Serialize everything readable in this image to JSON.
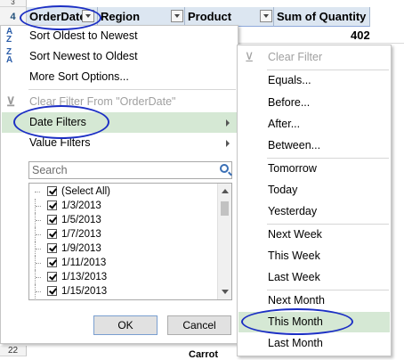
{
  "sheet": {
    "row_numbers": [
      "3",
      "4",
      "22"
    ],
    "headers": [
      "OrderDate",
      "Region",
      "Product",
      "Sum of Quantity"
    ],
    "value": "402",
    "bottom_cell": "Carrot"
  },
  "menu": {
    "items": [
      {
        "label": "Sort Oldest to Newest",
        "icon": "sort-ascending-icon",
        "glyph": "A↓Z"
      },
      {
        "label": "Sort Newest to Oldest",
        "icon": "sort-descending-icon",
        "glyph": "Z↓A"
      },
      {
        "label": "More Sort Options...",
        "icon": ""
      },
      {
        "label": "Clear Filter From \"OrderDate\"",
        "icon": "clear-filter-icon",
        "disabled": true
      },
      {
        "label": "Date Filters",
        "has_submenu": true,
        "highlighted": true
      },
      {
        "label": "Value Filters",
        "has_submenu": true
      }
    ],
    "search_placeholder": "Search",
    "list_items": [
      {
        "label": "(Select All)",
        "checked": true
      },
      {
        "label": "1/3/2013",
        "checked": true
      },
      {
        "label": "1/5/2013",
        "checked": true
      },
      {
        "label": "1/7/2013",
        "checked": true
      },
      {
        "label": "1/9/2013",
        "checked": true
      },
      {
        "label": "1/11/2013",
        "checked": true
      },
      {
        "label": "1/13/2013",
        "checked": true
      },
      {
        "label": "1/15/2013",
        "checked": true
      }
    ],
    "ok_label": "OK",
    "cancel_label": "Cancel"
  },
  "submenu": {
    "items": [
      {
        "label": "Clear Filter",
        "disabled": true,
        "icon": "clear-filter-icon"
      },
      {
        "label": "Equals..."
      },
      {
        "label": "Before..."
      },
      {
        "label": "After..."
      },
      {
        "label": "Between..."
      },
      {
        "label": "Tomorrow"
      },
      {
        "label": "Today"
      },
      {
        "label": "Yesterday"
      },
      {
        "label": "Next Week"
      },
      {
        "label": "This Week"
      },
      {
        "label": "Last Week"
      },
      {
        "label": "Next Month"
      },
      {
        "label": "This Month",
        "highlighted": true
      },
      {
        "label": "Last Month"
      }
    ]
  },
  "colors": {
    "highlight": "#d5e8d4",
    "annotation": "#1c2fc4",
    "header_fill": "#dce6f1"
  }
}
